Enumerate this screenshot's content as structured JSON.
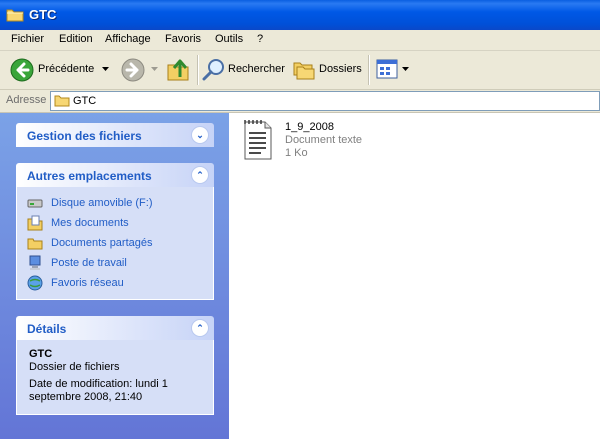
{
  "window": {
    "title": "GTC"
  },
  "menu": [
    "Fichier",
    "Edition",
    "Affichage",
    "Favoris",
    "Outils",
    "?"
  ],
  "toolbar": {
    "back_label": "Précédente",
    "search_label": "Rechercher",
    "folders_label": "Dossiers"
  },
  "address": {
    "label": "Adresse",
    "value": "GTC"
  },
  "tasks": {
    "file_management": {
      "title": "Gestion des fichiers"
    },
    "other_places": {
      "title": "Autres emplacements",
      "items": [
        "Disque amovible (F:)",
        "Mes documents",
        "Documents partagés",
        "Poste de travail",
        "Favoris réseau"
      ]
    },
    "details": {
      "title": "Détails",
      "name": "GTC",
      "type": "Dossier de fichiers",
      "modified": "Date de modification: lundi 1 septembre 2008, 21:40"
    }
  },
  "files": [
    {
      "name": "1_9_2008",
      "type": "Document texte",
      "size": "1 Ko"
    }
  ],
  "colors": {
    "title_bar": "#0054e3",
    "task_pane": "#7ba2e7",
    "link": "#215dc6"
  }
}
